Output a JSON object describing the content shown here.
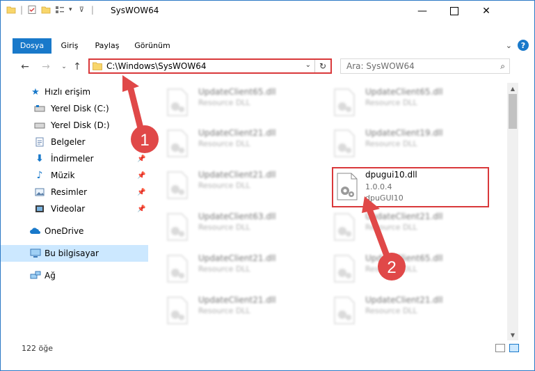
{
  "window": {
    "title": "SysWOW64"
  },
  "ribbon": {
    "tabs": [
      {
        "label": "Dosya"
      },
      {
        "label": "Giriş"
      },
      {
        "label": "Paylaş"
      },
      {
        "label": "Görünüm"
      }
    ]
  },
  "address": {
    "path": "C:\\Windows\\SysWOW64"
  },
  "search": {
    "placeholder": "Ara: SysWOW64"
  },
  "sidebar": {
    "items": [
      {
        "label": "Hızlı erişim",
        "icon": "star-icon"
      },
      {
        "label": "Yerel Disk (C:)",
        "icon": "drive-icon"
      },
      {
        "label": "Yerel Disk (D:)",
        "icon": "drive-icon"
      },
      {
        "label": "Belgeler",
        "icon": "document-icon"
      },
      {
        "label": "İndirmeler",
        "icon": "download-icon"
      },
      {
        "label": "Müzik",
        "icon": "music-icon"
      },
      {
        "label": "Resimler",
        "icon": "pictures-icon"
      },
      {
        "label": "Videolar",
        "icon": "video-icon"
      },
      {
        "label": "OneDrive",
        "icon": "cloud-icon"
      },
      {
        "label": "Bu bilgisayar",
        "icon": "computer-icon"
      },
      {
        "label": "Ağ",
        "icon": "network-icon"
      }
    ]
  },
  "files": [
    {
      "name": "UpdateClient65.dll",
      "line2": "Resource DLL",
      "line3": ""
    },
    {
      "name": "UpdateClient65.dll",
      "line2": "Resource DLL",
      "line3": ""
    },
    {
      "name": "UpdateClient21.dll",
      "line2": "Resource DLL",
      "line3": ""
    },
    {
      "name": "UpdateClient19.dll",
      "line2": "Resource DLL",
      "line3": ""
    },
    {
      "name": "UpdateClient21.dll",
      "line2": "Resource DLL",
      "line3": ""
    },
    {
      "name": "dpugui10.dll",
      "line2": "1.0.0.4",
      "line3": "dpuGUI10"
    },
    {
      "name": "UpdateClient63.dll",
      "line2": "Resource DLL",
      "line3": ""
    },
    {
      "name": "UpdateClient21.dll",
      "line2": "Resource DLL",
      "line3": ""
    },
    {
      "name": "UpdateClient21.dll",
      "line2": "Resource DLL",
      "line3": ""
    },
    {
      "name": "UpdateClient65.dll",
      "line2": "Resource DLL",
      "line3": ""
    },
    {
      "name": "UpdateClient21.dll",
      "line2": "Resource DLL",
      "line3": ""
    },
    {
      "name": "UpdateClient21.dll",
      "line2": "Resource DLL",
      "line3": ""
    }
  ],
  "status": {
    "count": "122 öğe"
  },
  "annotations": {
    "step1": "1",
    "step2": "2"
  },
  "colors": {
    "accent": "#1979ca",
    "highlight": "#d9383a",
    "selected": "#cce8ff"
  }
}
